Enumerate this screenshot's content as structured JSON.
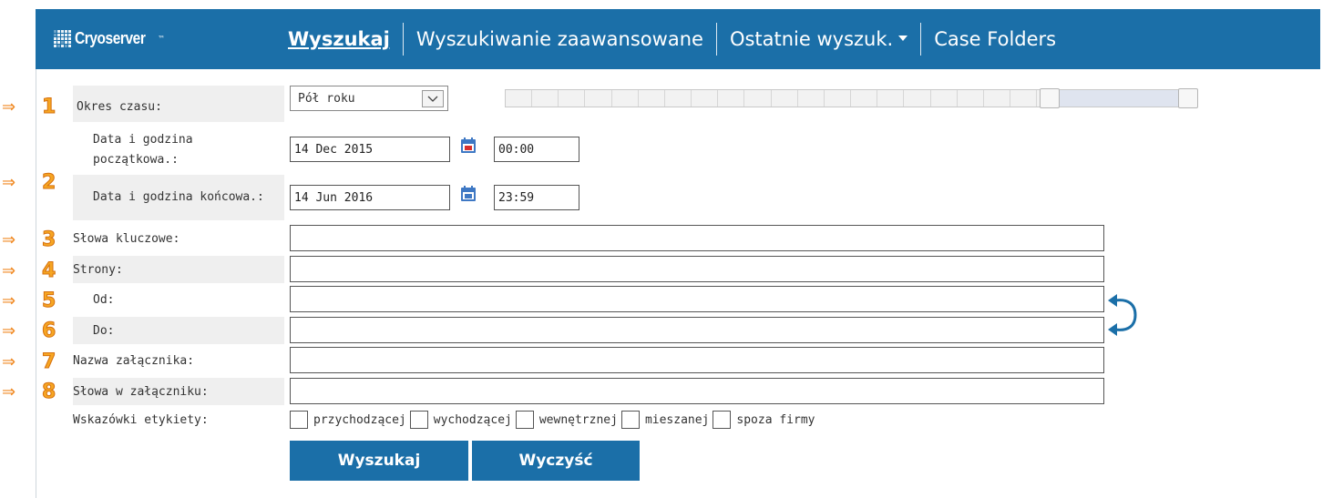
{
  "header": {
    "logo_text": "Cryoserver",
    "logo_tm": "™",
    "nav": {
      "search": "Wyszukaj",
      "advanced": "Wyszukiwanie zaawansowane",
      "recent": "Ostatnie wyszuk.",
      "case_folders": "Case Folders"
    }
  },
  "markers": {
    "arrow": "⇒",
    "numbers": [
      "1",
      "2",
      "3",
      "4",
      "5",
      "6",
      "7",
      "8"
    ]
  },
  "form": {
    "period": {
      "label": "Okres czasu:",
      "value": "Pół roku"
    },
    "start": {
      "label": "Data i godzina początkowa.:",
      "date": "14 Dec 2015",
      "time": "00:00"
    },
    "end": {
      "label": "Data i godzina końcowa.:",
      "date": "14 Jun 2016",
      "time": "23:59"
    },
    "keywords": {
      "label": "Słowa kluczowe:",
      "value": ""
    },
    "pages": {
      "label": "Strony:",
      "value": ""
    },
    "from": {
      "label": "Od:",
      "value": ""
    },
    "to": {
      "label": "Do:",
      "value": ""
    },
    "attachment_name": {
      "label": "Nazwa załącznika:",
      "value": ""
    },
    "attachment_words": {
      "label": "Słowa w załączniku:",
      "value": ""
    },
    "tags": {
      "label": "Wskazówki etykiety:",
      "options": [
        "przychodzącej",
        "wychodzącej",
        "wewnętrznej",
        "mieszanej",
        "spoza firmy"
      ]
    },
    "search_button": "Wyszukaj",
    "clear_button": "Wyczyść"
  },
  "colors": {
    "header_bg": "#1b6fa8",
    "marker": "#f6a623",
    "slider_range": "#dfe4ef"
  },
  "icons": {
    "calendar": "calendar-icon",
    "swap": "swap-arrows-icon",
    "dropdown": "chevron-down-icon"
  }
}
